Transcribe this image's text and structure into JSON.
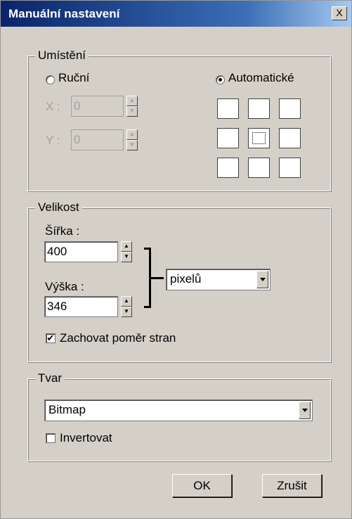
{
  "window": {
    "title": "Manuální nastavení",
    "close_label": "X"
  },
  "placement": {
    "group_label": "Umístění",
    "manual_label": "Ruční",
    "automatic_label": "Automatické",
    "selected_mode": "automatic",
    "x_label": "X :",
    "x_value": "0",
    "y_label": "Y :",
    "y_value": "0",
    "selected_position": "center"
  },
  "size": {
    "group_label": "Velikost",
    "width_label": "Šířka :",
    "width_value": "400",
    "height_label": "Výška :",
    "height_value": "346",
    "unit": "pixelů",
    "keep_ratio_label": "Zachovat poměr stran",
    "keep_ratio_checked": true
  },
  "shape": {
    "group_label": "Tvar",
    "value": "Bitmap",
    "invert_label": "Invertovat",
    "invert_checked": false
  },
  "buttons": {
    "ok": "OK",
    "cancel": "Zrušit"
  },
  "icons": {
    "check": "✔",
    "spin_up": "▲",
    "spin_down": "▼"
  }
}
